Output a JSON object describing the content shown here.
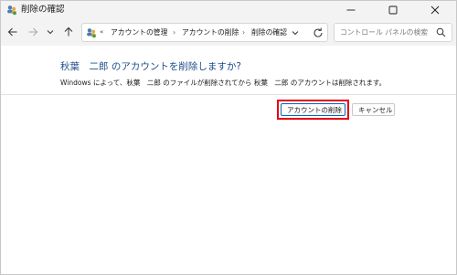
{
  "window": {
    "title": "削除の確認"
  },
  "nav": {
    "ellipsis": "«",
    "breadcrumbs": [
      {
        "label": "アカウントの管理"
      },
      {
        "label": "アカウントの削除"
      },
      {
        "label": "削除の確認"
      }
    ],
    "separator": "›",
    "search_placeholder": "コントロール パネルの検索"
  },
  "main": {
    "heading": "秋葉　二郎 のアカウントを削除しますか?",
    "message": "Windows によって、秋葉　二郎 のファイルが削除されてから 秋葉　二郎 のアカウントは削除されます。",
    "delete_button": "アカウントの削除",
    "cancel_button": "キャンセル"
  },
  "colors": {
    "heading": "#1f4e8c",
    "highlight": "#e60012",
    "primary_border": "#0067c0"
  },
  "icons": {
    "app": "control-panel-user-icon",
    "back": "arrow-left-icon",
    "forward": "arrow-right-icon",
    "recent": "chevron-down-icon",
    "up": "arrow-up-icon",
    "location": "user-accounts-icon",
    "dropdown": "chevron-down-icon",
    "refresh": "refresh-icon",
    "search": "search-icon",
    "minimize": "minimize-icon",
    "maximize": "maximize-icon",
    "close": "close-icon"
  }
}
